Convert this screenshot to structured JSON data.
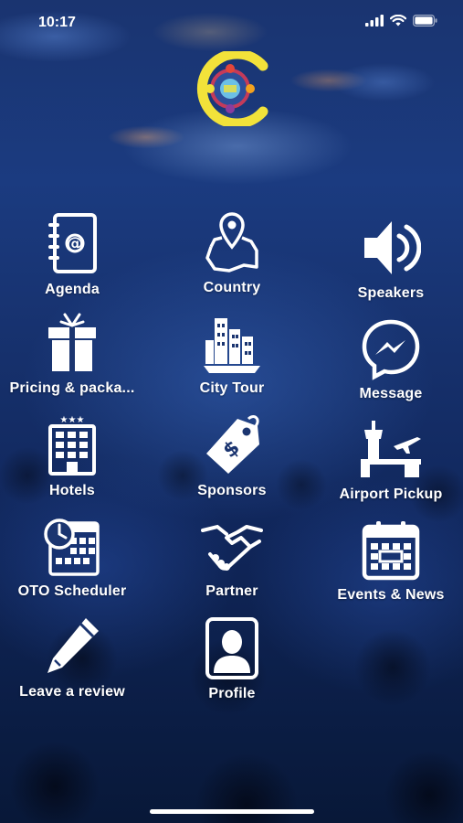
{
  "status_bar": {
    "time": "10:17"
  },
  "logo": {
    "alt_text": "CONFERENCE APP",
    "accent_color": "#f2e23a"
  },
  "menu": [
    {
      "label": "Agenda",
      "icon": "address-book-icon"
    },
    {
      "label": "Country",
      "icon": "map-pin-icon"
    },
    {
      "label": "Speakers",
      "icon": "speaker-icon"
    },
    {
      "label": "Pricing & packa...",
      "icon": "gift-icon"
    },
    {
      "label": "City Tour",
      "icon": "city-buildings-icon"
    },
    {
      "label": "Message",
      "icon": "messenger-icon"
    },
    {
      "label": "Hotels",
      "icon": "hotel-icon"
    },
    {
      "label": "Sponsors",
      "icon": "price-tag-icon"
    },
    {
      "label": "Airport Pickup",
      "icon": "airport-icon"
    },
    {
      "label": "OTO Scheduler",
      "icon": "scheduler-icon"
    },
    {
      "label": "Partner",
      "icon": "handshake-icon"
    },
    {
      "label": "Events & News",
      "icon": "calendar-icon"
    },
    {
      "label": "Leave a review",
      "icon": "pen-icon"
    },
    {
      "label": "Profile",
      "icon": "profile-icon"
    }
  ]
}
